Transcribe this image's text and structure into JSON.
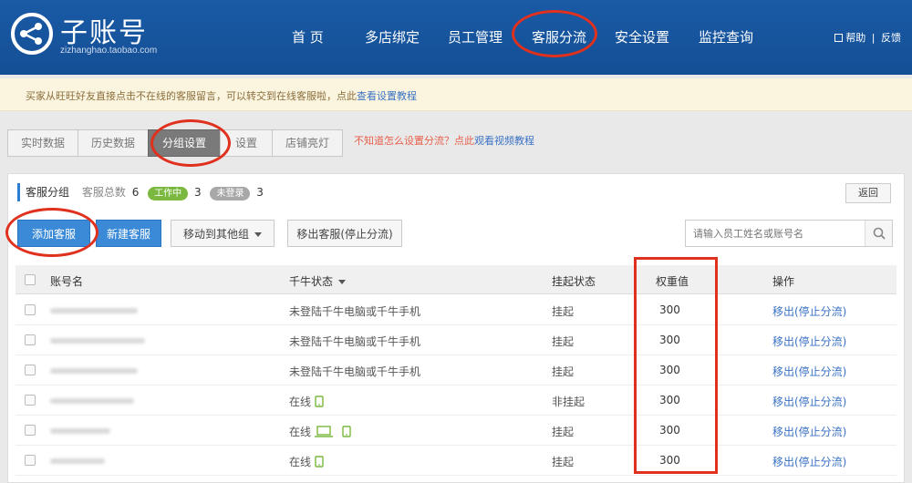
{
  "header": {
    "title": "子账号",
    "subtitle": "zizhanghao.taobao.com",
    "nav": [
      "首 页",
      "多店绑定",
      "员工管理",
      "客服分流",
      "安全设置",
      "监控查询"
    ],
    "help": "帮助",
    "separator": "|",
    "feedback": "反馈"
  },
  "notice": {
    "text": "买家从旺旺好友直接点击不在线的客服留言，可以转交到在线客服啦，点此",
    "link": "查看设置教程"
  },
  "tabs": [
    "实时数据",
    "历史数据",
    "分组设置",
    "设置",
    "店铺亮灯"
  ],
  "tab_help": {
    "text": "不知道怎么设置分流？点此",
    "link": "观看视频教程"
  },
  "group": {
    "title": "客服分组",
    "total_label": "客服总数",
    "total": "6",
    "working_label": "工作中",
    "working": "3",
    "offline_label": "未登录",
    "offline": "3",
    "back": "返回"
  },
  "toolbar": {
    "add": "添加客服",
    "new": "新建客服",
    "move": "移动到其他组",
    "remove": "移出客服(停止分流)",
    "search_placeholder": "请输入员工姓名或账号名"
  },
  "table": {
    "headers": {
      "account": "账号名",
      "status": "千牛状态",
      "hang": "挂起状态",
      "weight": "权重值",
      "op": "操作"
    },
    "rows": [
      {
        "status": "未登陆千牛电脑或千牛手机",
        "devices": [],
        "hang": "挂起",
        "weight": "300",
        "op": "移出(停止分流)"
      },
      {
        "status": "未登陆千牛电脑或千牛手机",
        "devices": [],
        "hang": "挂起",
        "weight": "300",
        "op": "移出(停止分流)"
      },
      {
        "status": "未登陆千牛电脑或千牛手机",
        "devices": [],
        "hang": "挂起",
        "weight": "300",
        "op": "移出(停止分流)"
      },
      {
        "status": "在线",
        "devices": [
          "phone"
        ],
        "hang": "非挂起",
        "weight": "300",
        "op": "移出(停止分流)"
      },
      {
        "status": "在线",
        "devices": [
          "laptop",
          "phone"
        ],
        "hang": "挂起",
        "weight": "300",
        "op": "移出(停止分流)"
      },
      {
        "status": "在线",
        "devices": [
          "phone"
        ],
        "hang": "挂起",
        "weight": "300",
        "op": "移出(停止分流)"
      }
    ]
  },
  "colors": {
    "header": "#1a5aa6",
    "accent": "#3a8ad8",
    "annotation": "#e0301e",
    "online_device": "#7ab83f"
  }
}
